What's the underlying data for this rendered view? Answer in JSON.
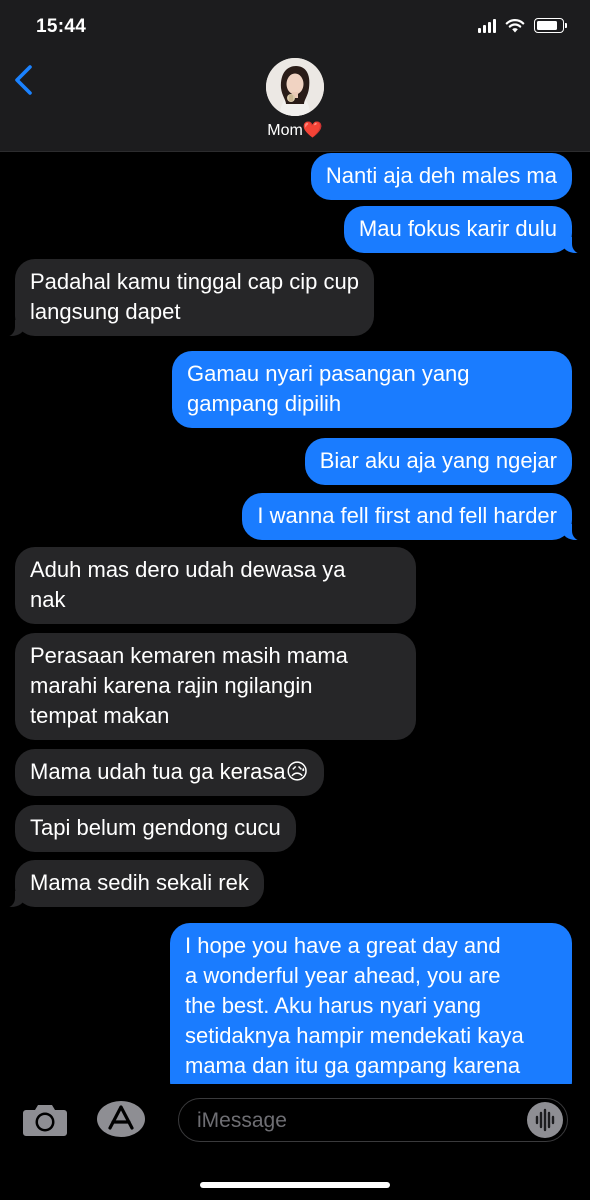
{
  "status_bar": {
    "time": "15:44"
  },
  "header": {
    "contact_name": "Mom",
    "contact_emoji": "❤️"
  },
  "messages": [
    {
      "side": "sent",
      "text": "Nanti aja deh males ma"
    },
    {
      "side": "sent",
      "text": "Mau fokus karir dulu"
    },
    {
      "side": "recv",
      "text": "Padahal kamu tinggal cap cip cup\nlangsung dapet"
    },
    {
      "side": "sent",
      "text": "Gamau nyari pasangan yang\ngampang dipilih"
    },
    {
      "side": "sent",
      "text": "Biar aku aja yang ngejar"
    },
    {
      "side": "sent",
      "text": "I wanna fell first and fell harder"
    },
    {
      "side": "recv",
      "text": "Aduh mas dero udah dewasa ya\nnak"
    },
    {
      "side": "recv",
      "text": "Perasaan kemaren masih mama\nmarahi karena rajin ngilangin\ntempat makan"
    },
    {
      "side": "recv",
      "text": "Mama udah tua ga kerasa😥"
    },
    {
      "side": "recv",
      "text": "Tapi belum gendong cucu"
    },
    {
      "side": "recv",
      "text": "Mama sedih sekali rek"
    },
    {
      "side": "sent",
      "text": "I hope you have a great day and\na wonderful year ahead, you are\nthe best. Aku harus nyari yang\nsetidaknya hampir mendekati kaya\nmama dan itu ga gampang karena"
    }
  ],
  "compose": {
    "placeholder": "iMessage"
  }
}
